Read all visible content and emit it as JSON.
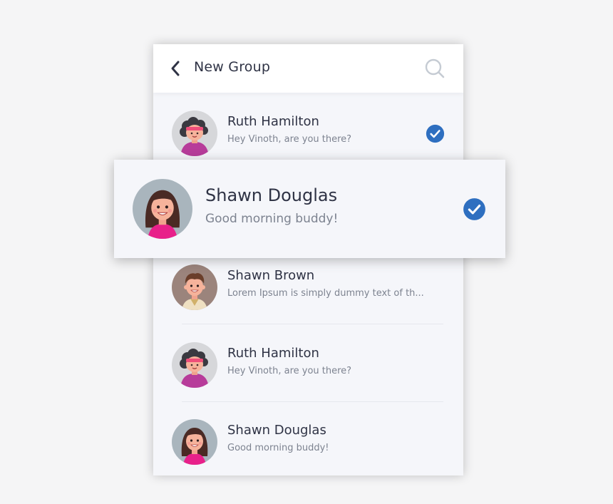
{
  "header": {
    "title": "New Group",
    "back_icon": "chevron-left-icon",
    "search_icon": "search-icon"
  },
  "contacts": [
    {
      "name": "Ruth Hamilton",
      "message": "Hey Vinoth, are you there?",
      "selected": true,
      "avatar": "woman-curly-hair"
    },
    {
      "name": "Shawn Douglas",
      "message": "Good morning buddy!",
      "selected": true,
      "avatar": "woman-long-hair"
    },
    {
      "name": "Shawn Brown",
      "message": "Lorem Ipsum is simply dummy text of th...",
      "selected": false,
      "avatar": "man-brown-hair"
    },
    {
      "name": "Ruth Hamilton",
      "message": "Hey Vinoth, are you there?",
      "selected": false,
      "avatar": "woman-curly-hair"
    },
    {
      "name": "Shawn Douglas",
      "message": "Good morning buddy!",
      "selected": false,
      "avatar": "woman-long-hair"
    }
  ],
  "colors": {
    "accent": "#2e6fc0",
    "text": "#2f3345",
    "subtext": "#7d8390"
  }
}
